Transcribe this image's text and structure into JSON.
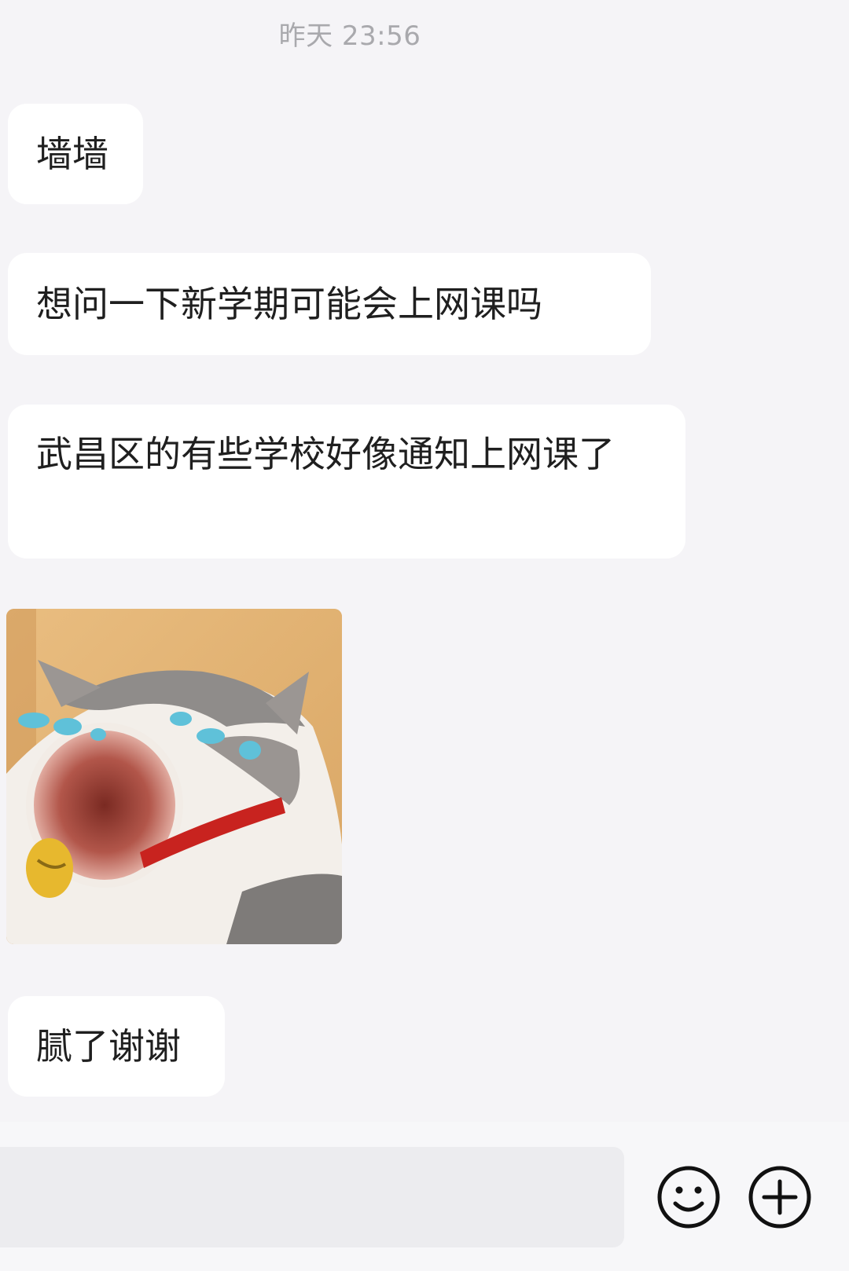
{
  "chat": {
    "timestamp": "昨天 23:56",
    "messages": [
      {
        "type": "text",
        "text": "墙墙"
      },
      {
        "type": "text",
        "text": "想问一下新学期可能会上网课吗"
      },
      {
        "type": "text",
        "text": "武昌区的有些学校好像通知上网课了"
      },
      {
        "type": "sticker",
        "icon": "crying-cat-sticker"
      },
      {
        "type": "text",
        "text": "腻了谢谢"
      }
    ]
  },
  "input_bar": {
    "text_value": "",
    "emoji_icon": "smiley-face-icon",
    "plus_icon": "plus-circle-icon"
  },
  "colors": {
    "background": "#f5f4f7",
    "bubble": "#ffffff",
    "timestamp": "#a9a9ad",
    "input_box": "#ececef",
    "icon": "#111111"
  }
}
